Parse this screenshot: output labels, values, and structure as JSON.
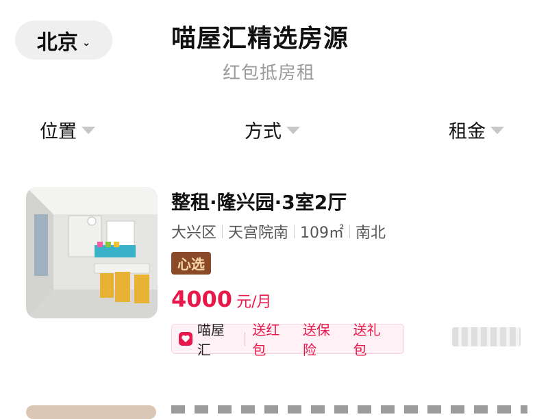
{
  "header": {
    "city": "北京",
    "title": "喵屋汇精选房源",
    "subtitle": "红包抵房租"
  },
  "filters": [
    {
      "label": "位置"
    },
    {
      "label": "方式"
    },
    {
      "label": "租金"
    }
  ],
  "listing": {
    "title": "整租·隆兴园·3室2厅",
    "tags": [
      "大兴区",
      "天宫院南",
      "109㎡",
      "南北"
    ],
    "badge": "心选",
    "price": "4000",
    "price_unit": "元/月",
    "promo": {
      "brand": "喵屋汇",
      "perks": [
        "送红包",
        "送保险",
        "送礼包"
      ]
    }
  },
  "colors": {
    "accent": "#e8184a",
    "badge_bg": "#8a4a2a",
    "badge_text": "#f7d9a8"
  }
}
